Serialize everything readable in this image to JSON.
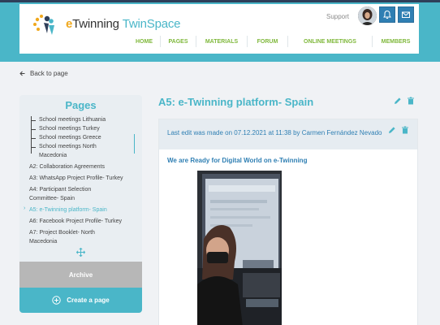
{
  "header": {
    "logo": {
      "e": "e",
      "twinning": "Twinning",
      "twinspace": "TwinSpace"
    },
    "support_label": "Support",
    "nav": [
      "HOME",
      "PAGES",
      "MATERIALS",
      "FORUM",
      "ONLINE MEETINGS",
      "MEMBERS"
    ]
  },
  "back_label": "Back to page",
  "sidebar": {
    "title": "Pages",
    "items": [
      {
        "label": "School meetings Lithuania"
      },
      {
        "label": "School meetings Turkey"
      },
      {
        "label": "School meetings Greece"
      },
      {
        "label": "School meetings North"
      },
      {
        "label": "Macedonia"
      },
      {
        "label": "A2: Collaboration Agreements"
      },
      {
        "label": "A3: WhatsApp Project Profile- Turkey"
      },
      {
        "label": "A4: Participant Selection"
      },
      {
        "label": "Committee- Spain"
      },
      {
        "label": "A5: e-Twinning platform- Spain"
      },
      {
        "label": "A6: Facebook Project Profile- Turkey"
      },
      {
        "label": "A7: Project Booklet- North"
      },
      {
        "label": "Macedonia"
      }
    ],
    "archive_label": "Archive",
    "create_label": "Create a page"
  },
  "main": {
    "title": "A5: e-Twinning platform- Spain",
    "last_edit": "Last edit was made on 07.12.2021 at 11:38 by Carmen Fernández Nevado",
    "subheading": "We are Ready for Digital World on e-Twinning"
  },
  "colors": {
    "accent": "#4ab6c8",
    "nav_green": "#7fb83b",
    "link_blue": "#2f7fb3"
  },
  "icons": [
    "bell-icon",
    "mail-icon",
    "pencil-icon",
    "trash-icon",
    "move-icon",
    "plus-circle-icon",
    "back-arrow-icon"
  ]
}
